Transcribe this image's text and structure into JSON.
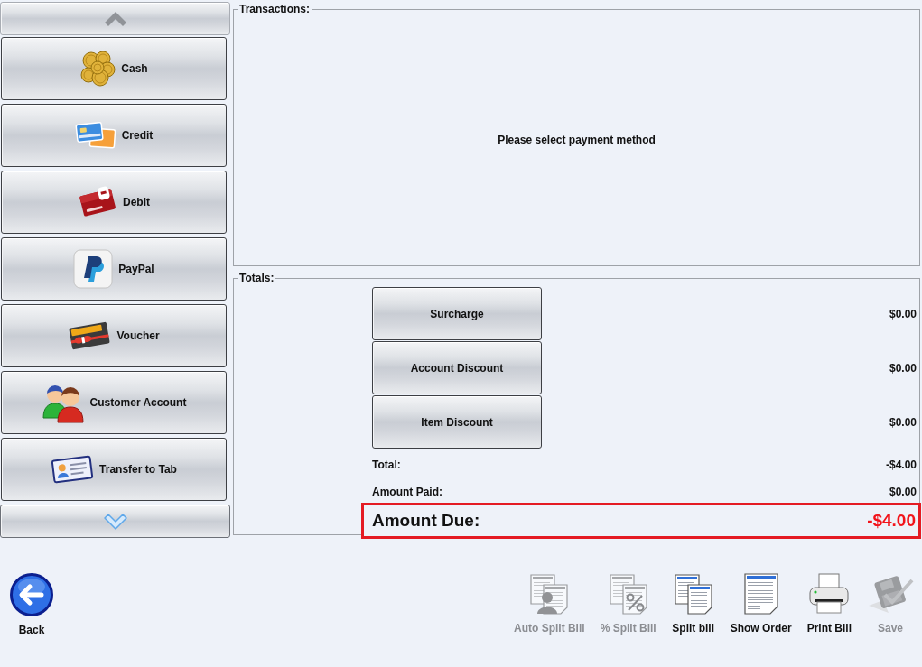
{
  "sidebar": {
    "scroll_up": {
      "disabled": true
    },
    "payment_methods": [
      {
        "label": "Cash",
        "kind": "cash"
      },
      {
        "label": "Credit",
        "kind": "credit"
      },
      {
        "label": "Debit",
        "kind": "debit"
      },
      {
        "label": "PayPal",
        "kind": "paypal"
      },
      {
        "label": "Voucher",
        "kind": "voucher"
      },
      {
        "label": "Customer Account",
        "kind": "account"
      },
      {
        "label": "Transfer to Tab",
        "kind": "tab"
      }
    ],
    "scroll_down": {
      "disabled": false
    }
  },
  "transactions": {
    "title": "Transactions:",
    "message": "Please select payment method"
  },
  "totals": {
    "title": "Totals:",
    "adjustments": [
      {
        "label": "Surcharge",
        "amount": "$0.00"
      },
      {
        "label": "Account Discount",
        "amount": "$0.00"
      },
      {
        "label": "Item Discount",
        "amount": "$0.00"
      }
    ],
    "lines": [
      {
        "label": "Total:",
        "amount": "-$4.00"
      },
      {
        "label": "Amount Paid:",
        "amount": "$0.00"
      }
    ],
    "amount_due": {
      "label": "Amount Due:",
      "amount": "-$4.00",
      "highlighted": true
    }
  },
  "toolbar": {
    "back": {
      "label": "Back"
    },
    "actions": [
      {
        "label": "Auto Split Bill",
        "kind": "auto_split",
        "disabled": true
      },
      {
        "label": "% Split Bill",
        "kind": "percent_split",
        "disabled": true
      },
      {
        "label": "Split bill",
        "kind": "split",
        "disabled": false
      },
      {
        "label": "Show Order",
        "kind": "show_order",
        "disabled": false
      },
      {
        "label": "Print Bill",
        "kind": "print",
        "disabled": false
      },
      {
        "label": "Save",
        "kind": "save",
        "disabled": true
      }
    ]
  }
}
